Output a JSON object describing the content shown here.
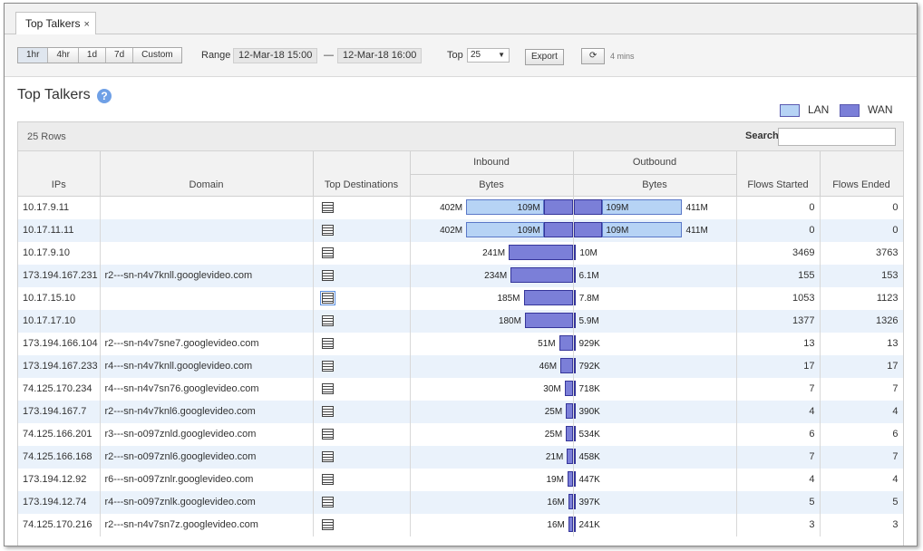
{
  "tab": {
    "label": "Top Talkers",
    "close": "×"
  },
  "toolbar": {
    "ranges": [
      "1hr",
      "4hr",
      "1d",
      "7d",
      "Custom"
    ],
    "range_label": "Range",
    "start": "12-Mar-18 15:00",
    "dash": "—",
    "end": "12-Mar-18 16:00",
    "top_label": "Top",
    "top_value": "25",
    "export_label": "Export",
    "refresh_icon": "⟳",
    "refresh_age": "4 mins"
  },
  "page": {
    "title": "Top Talkers",
    "help": "?"
  },
  "legend": {
    "lan_label": "LAN",
    "wan_label": "WAN",
    "lan_color": "#b6d3f5",
    "wan_color": "#7b7fd8"
  },
  "table": {
    "row_count": "25 Rows",
    "search_label": "Search",
    "headers": {
      "ips": "IPs",
      "domain": "Domain",
      "top_dest": "Top Destinations",
      "inbound": "Inbound",
      "outbound": "Outbound",
      "in_bytes": "Bytes",
      "out_bytes": "Bytes",
      "flows_started": "Flows Started",
      "flows_ended": "Flows Ended"
    },
    "rows": [
      {
        "ip": "10.17.9.11",
        "domain": "",
        "in_total": "402M",
        "in_wan": "109M",
        "in_total_v": 402,
        "in_wan_v": 109,
        "out_total": "411M",
        "out_wan": "109M",
        "out_total_v": 411,
        "out_wan_v": 109,
        "started": "0",
        "ended": "0"
      },
      {
        "ip": "10.17.11.11",
        "domain": "",
        "in_total": "402M",
        "in_wan": "109M",
        "in_total_v": 402,
        "in_wan_v": 109,
        "out_total": "411M",
        "out_wan": "109M",
        "out_total_v": 411,
        "out_wan_v": 109,
        "started": "0",
        "ended": "0"
      },
      {
        "ip": "10.17.9.10",
        "domain": "",
        "in_total": "241M",
        "in_total_v": 241,
        "out_total": "10M",
        "out_total_v": 10,
        "started": "3469",
        "ended": "3763"
      },
      {
        "ip": "173.194.167.231",
        "domain": "r2---sn-n4v7knll.googlevideo.com",
        "in_total": "234M",
        "in_total_v": 234,
        "out_total": "6.1M",
        "out_total_v": 6.1,
        "started": "155",
        "ended": "153"
      },
      {
        "ip": "10.17.15.10",
        "domain": "",
        "in_total": "185M",
        "in_total_v": 185,
        "out_total": "7.8M",
        "out_total_v": 7.8,
        "started": "1053",
        "ended": "1123",
        "selected": true
      },
      {
        "ip": "10.17.17.10",
        "domain": "",
        "in_total": "180M",
        "in_total_v": 180,
        "out_total": "5.9M",
        "out_total_v": 5.9,
        "started": "1377",
        "ended": "1326"
      },
      {
        "ip": "173.194.166.104",
        "domain": "r2---sn-n4v7sne7.googlevideo.com",
        "in_total": "51M",
        "in_total_v": 51,
        "out_total": "929K",
        "out_total_v": 0.93,
        "started": "13",
        "ended": "13"
      },
      {
        "ip": "173.194.167.233",
        "domain": "r4---sn-n4v7knll.googlevideo.com",
        "in_total": "46M",
        "in_total_v": 46,
        "out_total": "792K",
        "out_total_v": 0.79,
        "started": "17",
        "ended": "17"
      },
      {
        "ip": "74.125.170.234",
        "domain": "r4---sn-n4v7sn76.googlevideo.com",
        "in_total": "30M",
        "in_total_v": 30,
        "out_total": "718K",
        "out_total_v": 0.72,
        "started": "7",
        "ended": "7"
      },
      {
        "ip": "173.194.167.7",
        "domain": "r2---sn-n4v7knl6.googlevideo.com",
        "in_total": "25M",
        "in_total_v": 25,
        "out_total": "390K",
        "out_total_v": 0.39,
        "started": "4",
        "ended": "4"
      },
      {
        "ip": "74.125.166.201",
        "domain": "r3---sn-o097znld.googlevideo.com",
        "in_total": "25M",
        "in_total_v": 25,
        "out_total": "534K",
        "out_total_v": 0.53,
        "started": "6",
        "ended": "6"
      },
      {
        "ip": "74.125.166.168",
        "domain": "r2---sn-o097znl6.googlevideo.com",
        "in_total": "21M",
        "in_total_v": 21,
        "out_total": "458K",
        "out_total_v": 0.46,
        "started": "7",
        "ended": "7"
      },
      {
        "ip": "173.194.12.92",
        "domain": "r6---sn-o097znlr.googlevideo.com",
        "in_total": "19M",
        "in_total_v": 19,
        "out_total": "447K",
        "out_total_v": 0.45,
        "started": "4",
        "ended": "4"
      },
      {
        "ip": "173.194.12.74",
        "domain": "r4---sn-o097znlk.googlevideo.com",
        "in_total": "16M",
        "in_total_v": 16,
        "out_total": "397K",
        "out_total_v": 0.4,
        "started": "5",
        "ended": "5"
      },
      {
        "ip": "74.125.170.216",
        "domain": "r2---sn-n4v7sn7z.googlevideo.com",
        "in_total": "16M",
        "in_total_v": 16,
        "out_total": "241K",
        "out_total_v": 0.24,
        "started": "3",
        "ended": "3"
      }
    ]
  }
}
